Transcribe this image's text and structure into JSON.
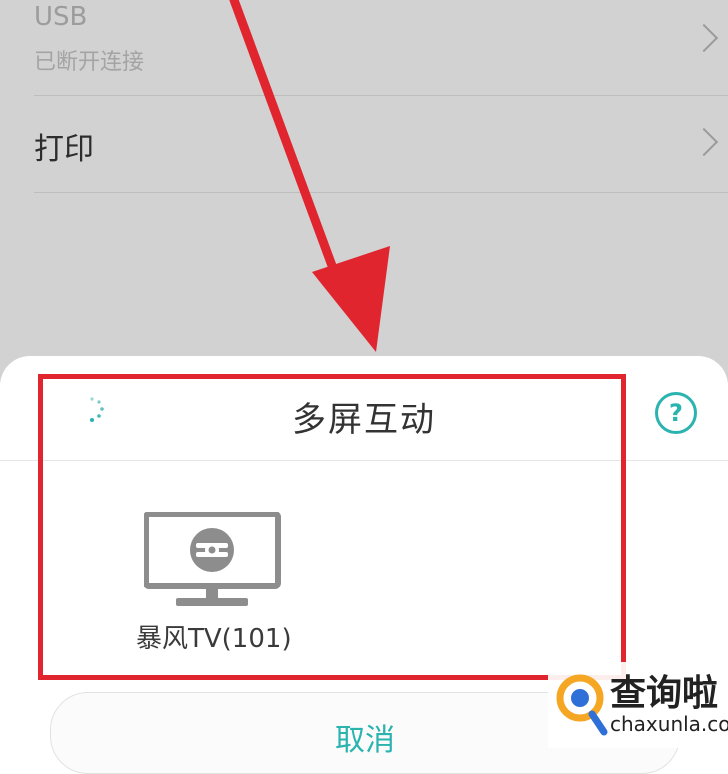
{
  "settings": {
    "usb": {
      "title": "USB",
      "subtitle": "已断开连接"
    },
    "print": {
      "title": "打印"
    }
  },
  "dialog": {
    "title": "多屏互动",
    "help_symbol": "?",
    "devices": [
      {
        "label": "暴风TV(101)",
        "icon": "tv-icon"
      }
    ],
    "cancel_label": "取消"
  },
  "watermark": {
    "name": "查询啦",
    "url": "chaxunla.com"
  },
  "colors": {
    "accent": "#2bb3b0",
    "annotation": "#e0252f",
    "dim_background": "#d2d2d2"
  }
}
